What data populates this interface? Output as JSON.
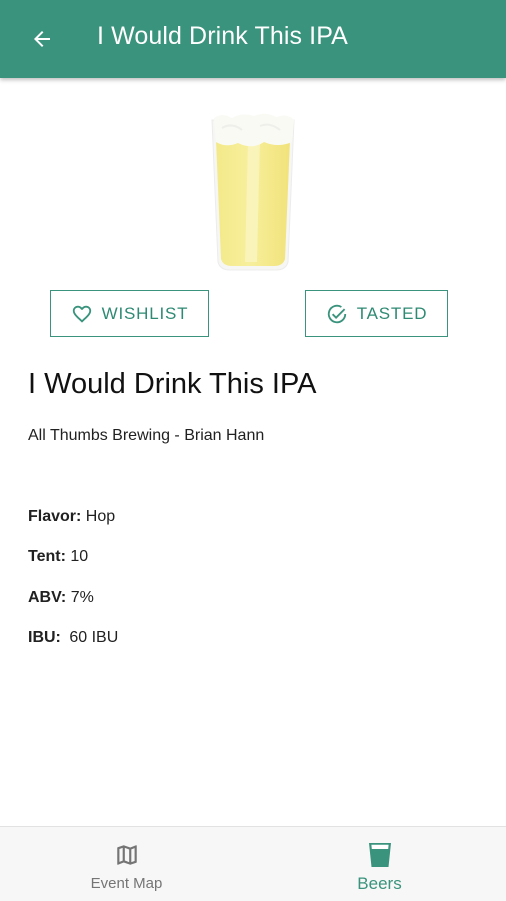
{
  "app_bar": {
    "title": "I Would Drink This IPA",
    "back_icon": "arrow-back-icon",
    "color": "#3a937c"
  },
  "image": {
    "icon": "beer-glass-image"
  },
  "actions": {
    "wishlist_label": "WISHLIST",
    "wishlist_icon": "heart-outline-icon",
    "tasted_label": "TASTED",
    "tasted_icon": "check-circle-outline-icon"
  },
  "beer": {
    "name": "I Would Drink This IPA",
    "brewer": "All Thumbs Brewing - Brian Hann",
    "attributes": [
      {
        "label": "Flavor:",
        "value": "Hop"
      },
      {
        "label": "Tent:",
        "value": "10"
      },
      {
        "label": "ABV:",
        "value": "7%"
      },
      {
        "label": "IBU:",
        "value": "60 IBU"
      }
    ]
  },
  "bottom_nav": {
    "items": [
      {
        "label": "Event Map",
        "icon": "map-icon",
        "active": false
      },
      {
        "label": "Beers",
        "icon": "beer-glass-icon",
        "active": true
      }
    ],
    "active_color": "#3a937c",
    "inactive_color": "#757575"
  }
}
